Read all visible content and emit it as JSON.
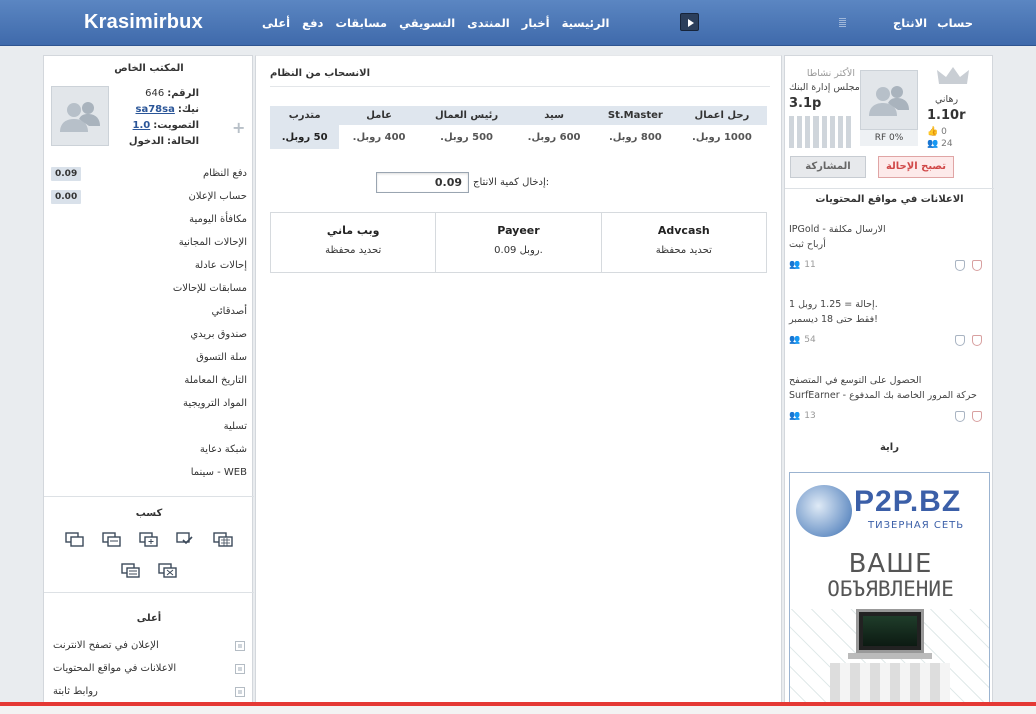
{
  "header": {
    "logo": "Krasimirbux",
    "nav": [
      "الرئيسية",
      "أخبار",
      "المنتدى",
      "التسويقي",
      "مسابقات",
      "دفع",
      "أعلى"
    ],
    "account": [
      "حساب",
      "الانتاج"
    ]
  },
  "left": {
    "title": "المكتب الخاص",
    "id_label": "الرقم:",
    "id_value": "646",
    "nick_label": "نيك:",
    "nick_value": "sa78sa",
    "vote_label": "التصويت:",
    "vote_value": "1.0",
    "status_label": "الحالة:",
    "status_value": "الدخول",
    "menu": [
      {
        "label": "دفع النظام",
        "badge": "0.09"
      },
      {
        "label": "حساب الإعلان",
        "badge": "0.00"
      },
      {
        "label": "مكافأة اليومية",
        "badge": ""
      },
      {
        "label": "الإحالات المجانية",
        "badge": ""
      },
      {
        "label": "إحالات عادلة",
        "badge": ""
      },
      {
        "label": "مسابقات للإحالات",
        "badge": ""
      },
      {
        "label": "أصدقائي",
        "badge": ""
      },
      {
        "label": "صندوق بريدي",
        "badge": ""
      },
      {
        "label": "سلة التسوق",
        "badge": ""
      },
      {
        "label": "التاريخ المعاملة",
        "badge": ""
      },
      {
        "label": "المواد الترويجية",
        "badge": ""
      },
      {
        "label": "تسلية",
        "badge": ""
      },
      {
        "label": "شبكة دعاية",
        "badge": ""
      },
      {
        "label": "سينما - WEB",
        "badge": ""
      }
    ],
    "earn_title": "كسب",
    "top_title": "أعلى",
    "top_items": [
      "الإعلان في تصفح الانترنت",
      "الاعلانات في مواقع المحتويات",
      "روابط ثابتة"
    ]
  },
  "main": {
    "title": "الانسحاب من النظام",
    "ranks": [
      {
        "name": "رحل اعمال",
        "price": "1000 روبل."
      },
      {
        "name": "St.Master",
        "price": "800 روبل."
      },
      {
        "name": "سيد",
        "price": "600 روبل."
      },
      {
        "name": "رئيس العمال",
        "price": "500 روبل."
      },
      {
        "name": "عامل",
        "price": "400 روبل."
      },
      {
        "name": "متدرب",
        "price": "50 روبل."
      }
    ],
    "amount_label": "إدخال كمية الانتاج:",
    "amount_value": "0.09",
    "payments": [
      {
        "name": "وبب ماني",
        "value": "تحديد محفظة"
      },
      {
        "name": "Payeer",
        "value": "0.09 روبل."
      },
      {
        "name": "Advcash",
        "value": "تحديد محفظة"
      }
    ]
  },
  "right": {
    "most_active": "الأكثر نشاطا",
    "bank": "مجلس إدارة البنك",
    "bank_score": "3.1p",
    "rf": "RF 0%",
    "rank_label": "رهاني",
    "rank_value": "1.10r",
    "likes": "0",
    "people": "24",
    "join_btn": "المشاركة",
    "fix_btn": "تصبح الإحالة",
    "ads_title": "الاعلانات في مواقع المحتويات",
    "ads": [
      {
        "line1": "IPGold - الارسال مكلفة",
        "line2": "أرباح ثبت",
        "count": "11"
      },
      {
        "line1": "1 إحالة = 1.25 روبل.",
        "line2": "فقط حتى 18 ديسمبر!",
        "count": "54"
      },
      {
        "line1": "الحصول على التوسع في المتصفح",
        "line2": "SurfEarner - حركة المرور الخاصة بك المدفوع",
        "count": "13"
      }
    ],
    "flag_title": "راية",
    "banner": {
      "brand": "P2P.BZ",
      "tagline": "ТИЗЕРНАЯ СЕТЬ",
      "line1": "ВАШЕ",
      "line2": "ОБЪЯВЛЕНИЕ"
    }
  },
  "colors": {
    "header": "#4a76b8",
    "accent_red": "#d04848",
    "badge_bg": "#d9e1ea"
  }
}
